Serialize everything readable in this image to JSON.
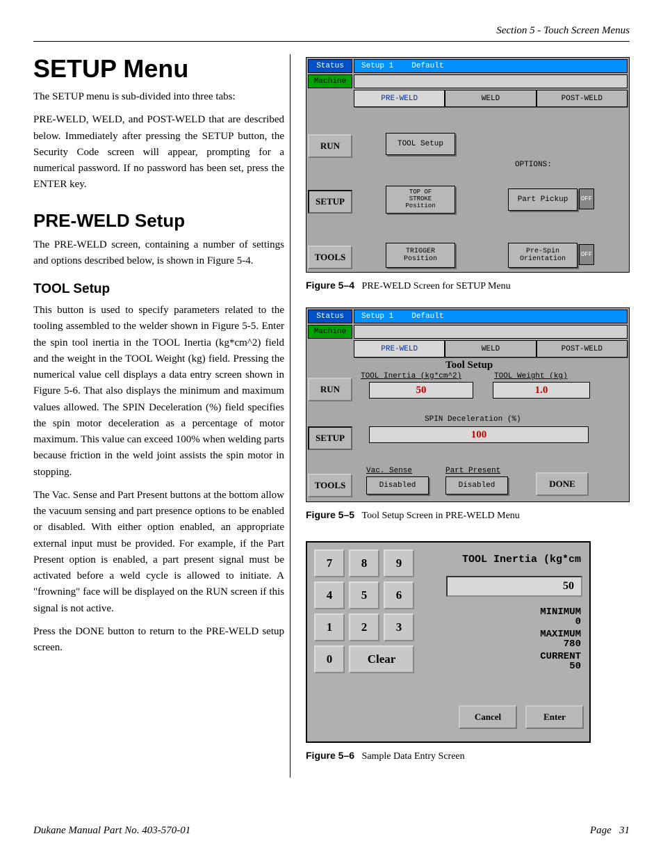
{
  "header": {
    "section": "Section 5 - Touch Screen Menus"
  },
  "left": {
    "h1": "SETUP Menu",
    "p1": "The SETUP menu is sub-divided into three tabs:",
    "p2": "PRE-WELD, WELD, and POST-WELD that are described below. Immediately after pressing the SETUP button, the Security Code screen will appear, prompting for a numerical password. If no password has been set, press the ENTER key.",
    "h2": "PRE-WELD Setup",
    "p3": "The PRE-WELD screen, containing a number of settings and options described below, is shown in Figure 5-4.",
    "h3": "TOOL Setup",
    "p4": "This button is used to specify parameters related to the tooling assembled to the welder shown in Figure 5-5. Enter the spin tool inertia in the TOOL Inertia (kg*cm^2) field and the weight in the TOOL Weight (kg) field. Pressing the numerical value cell displays a data entry screen shown in Figure 5-6. That also displays the minimum and maximum values allowed. The SPIN Deceleration (%) field specifies the spin motor deceleration as a percentage of motor maximum.  This value can exceed 100% when welding parts because friction in the weld joint assists the spin motor in stopping.",
    "p5": "The Vac. Sense and Part Present buttons at the bottom allow the vacuum sensing and part presence options to be enabled or disabled.  With either option enabled, an appropriate external input must be provided.  For example, if the Part Present option is enabled, a part present signal must be activated before a weld cycle is allowed to initiate.  A \"frowning\" face will be displayed on the RUN screen if this signal is not active.",
    "p6": "Press the DONE button to return to the PRE-WELD setup screen."
  },
  "fig54": {
    "caption_bold": "Figure 5–4",
    "caption": "PRE-WELD Screen for SETUP Menu",
    "status": "Status",
    "machine": "Machine",
    "titlebar_setup": "Setup 1",
    "titlebar_default": "Default",
    "tabs": {
      "pre": "PRE-WELD",
      "weld": "WELD",
      "post": "POST-WELD"
    },
    "side": {
      "run": "RUN",
      "setup": "SETUP",
      "tools": "TOOLS"
    },
    "btn_tool_setup": "TOOL Setup",
    "options_label": "OPTIONS:",
    "btn_top_stroke": "TOP OF\nSTROKE\nPosition",
    "btn_part_pickup": "Part Pickup",
    "btn_trigger": "TRIGGER\nPosition",
    "btn_prespin": "Pre-Spin\nOrientation",
    "off": "OFF"
  },
  "fig55": {
    "caption_bold": "Figure 5–5",
    "caption": "Tool Setup Screen in PRE-WELD Menu",
    "title": "Tool Setup",
    "inertia_label": "TOOL Inertia (kg*cm^2)",
    "inertia_val": "50",
    "weight_label": "TOOL Weight (kg)",
    "weight_val": "1.0",
    "decel_label": "SPIN Deceleration (%)",
    "decel_val": "100",
    "vac_label": "Vac. Sense",
    "vac_val": "Disabled",
    "pp_label": "Part Present",
    "pp_val": "Disabled",
    "done": "DONE"
  },
  "fig56": {
    "caption_bold": "Figure 5–6",
    "caption": "Sample Data Entry Screen",
    "keys": {
      "k7": "7",
      "k8": "8",
      "k9": "9",
      "k4": "4",
      "k5": "5",
      "k6": "6",
      "k1": "1",
      "k2": "2",
      "k3": "3",
      "k0": "0",
      "clear": "Clear"
    },
    "field_label": "TOOL Inertia (kg*cm",
    "value": "50",
    "min_label": "MINIMUM",
    "min_val": "0",
    "max_label": "MAXIMUM",
    "max_val": "780",
    "cur_label": "CURRENT",
    "cur_val": "50",
    "cancel": "Cancel",
    "enter": "Enter"
  },
  "footer": {
    "left": "Dukane Manual Part No. 403-570-01",
    "right_label": "Page",
    "right_num": "31"
  }
}
